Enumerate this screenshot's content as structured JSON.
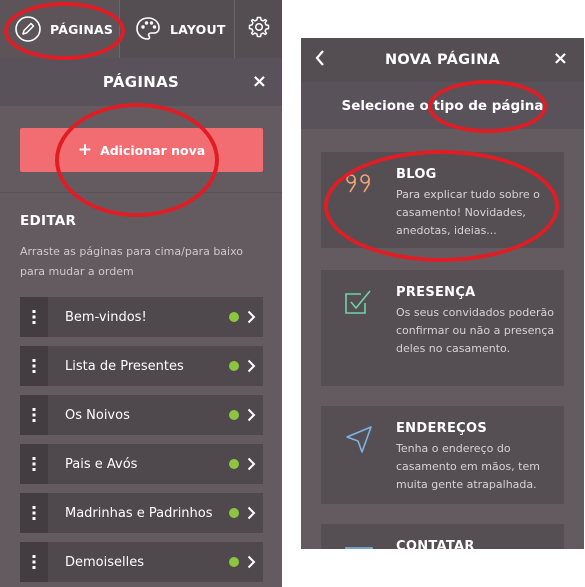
{
  "left_panel": {
    "tabs": {
      "pages": "PÁGINAS",
      "layout": "LAYOUT"
    },
    "section_title": "PÁGINAS",
    "close": "×",
    "add_button": "Adicionar nova",
    "edit_heading": "EDITAR",
    "hint": "Arraste as páginas para cima/para baixo para mudar a ordem",
    "pages": [
      {
        "name": "Bem-vindos!"
      },
      {
        "name": "Lista de Presentes"
      },
      {
        "name": "Os Noivos"
      },
      {
        "name": "Pais e Avós"
      },
      {
        "name": "Madrinhas e Padrinhos"
      },
      {
        "name": "Demoiselles"
      }
    ],
    "icons": {
      "pages_tab": "pencil-icon",
      "layout_tab": "palette-icon",
      "settings_tab": "gear-icon",
      "row_handle": "drag-handle-icon",
      "row_status": "status-dot",
      "row_chevron": "chevron-right-icon"
    }
  },
  "right_panel": {
    "title": "NOVA PÁGINA",
    "close": "×",
    "subtitle": "Selecione o tipo de página",
    "page_types": [
      {
        "title": "BLOG",
        "description": "Para explicar tudo sobre o casamento! Novidades, anedotas, ideias...",
        "icon": "quote-icon"
      },
      {
        "title": "PRESENÇA",
        "description": "Os seus convidados poderão confirmar ou não a presença deles no casamento.",
        "icon": "checkbox-icon"
      },
      {
        "title": "ENDEREÇOS",
        "description": "Tenha o endereço do casamento em mãos, tem muita gente atrapalhada.",
        "icon": "navigation-arrow-icon"
      },
      {
        "title": "CONTATAR",
        "description": "",
        "icon": "envelope-icon"
      }
    ]
  },
  "colors": {
    "panel_bg": "#635b60",
    "accent_button": "#f26d72",
    "status_green": "#8cc63f",
    "annotation_red": "#e01d24",
    "blog_icon": "#f5a37a",
    "presence_icon": "#6fd3a6",
    "address_icon": "#7fb3e3"
  }
}
